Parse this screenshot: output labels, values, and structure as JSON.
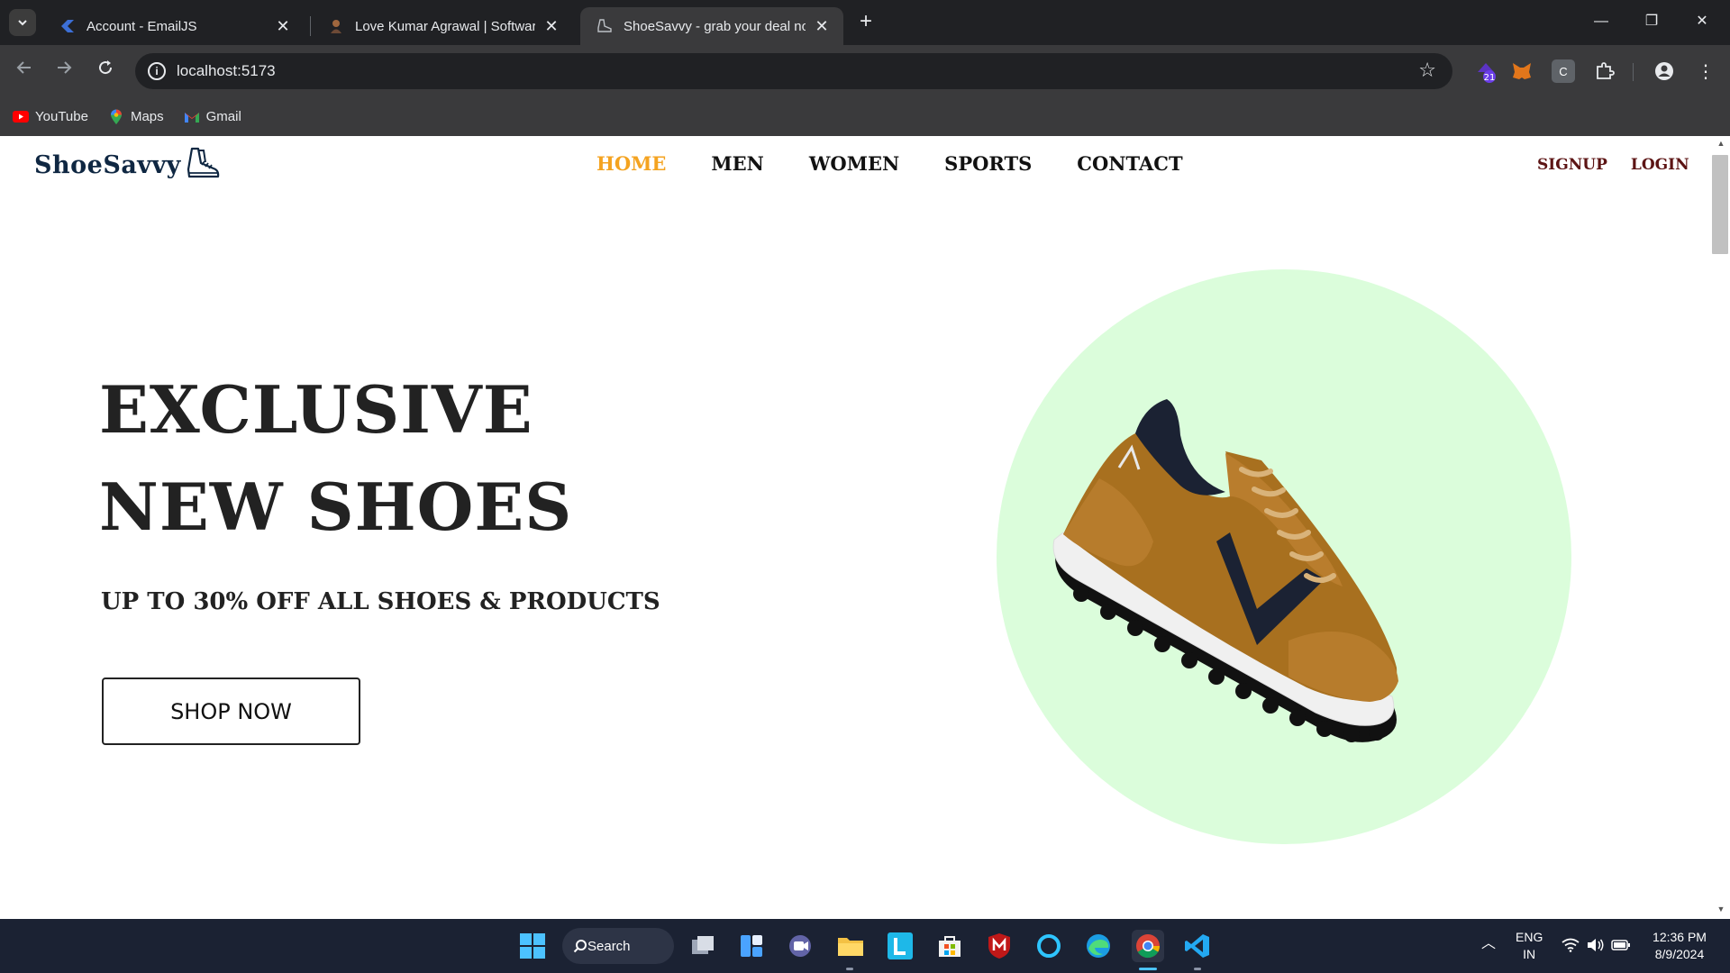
{
  "browser": {
    "tabs": [
      {
        "title": "Account - EmailJS",
        "active": false
      },
      {
        "title": "Love Kumar Agrawal | Software",
        "active": false
      },
      {
        "title": "ShoeSavvy - grab your deal now",
        "active": true
      }
    ],
    "url": "localhost:5173",
    "bookmarks": [
      {
        "label": "YouTube",
        "icon": "youtube-icon"
      },
      {
        "label": "Maps",
        "icon": "maps-icon"
      },
      {
        "label": "Gmail",
        "icon": "gmail-icon"
      }
    ],
    "extension_badge": "21"
  },
  "site": {
    "brand": "ShoeSavvy",
    "nav": [
      "HOME",
      "MEN",
      "WOMEN",
      "SPORTS",
      "CONTACT"
    ],
    "active_nav": "HOME",
    "auth": {
      "signup": "SIGNUP",
      "login": "LOGIN"
    },
    "hero": {
      "line1": "EXCLUSIVE",
      "line2": "NEW SHOES",
      "subtitle": "UP TO 30% OFF ALL SHOES & PRODUCTS",
      "cta": "SHOP NOW"
    },
    "colors": {
      "accent": "#f4a320",
      "circle": "#dbfddb",
      "auth": "#5c1414",
      "brand": "#0f2742"
    }
  },
  "taskbar": {
    "search_label": "Search",
    "language": {
      "line1": "ENG",
      "line2": "IN"
    },
    "time": "12:36 PM",
    "date": "8/9/2024"
  }
}
